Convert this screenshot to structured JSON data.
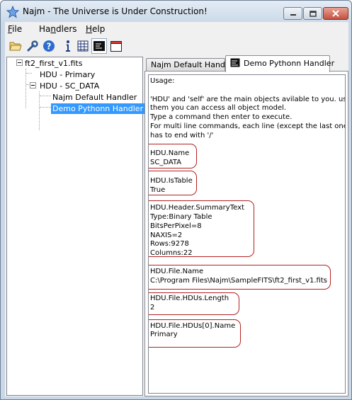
{
  "window": {
    "title": "Najm - The Universe is Under Construction!",
    "accent": "#3399ff",
    "annotation_color": "#b42121"
  },
  "caption_buttons": {
    "minimize_icon": "minimize-icon",
    "maximize_icon": "maximize-icon",
    "close_icon": "close-icon"
  },
  "menu": [
    {
      "label_acc": "F",
      "label_rest": "ile"
    },
    {
      "label_pre": "Ha",
      "label_acc": "n",
      "label_rest": "dlers"
    },
    {
      "label_acc": "H",
      "label_rest": "elp"
    }
  ],
  "toolbar": [
    "open-folder-icon",
    "wrench-icon",
    "help-icon",
    "info-icon",
    "grid-icon",
    "console-icon",
    "window-icon"
  ],
  "tree": {
    "root": "ft2_first_v1.fits",
    "hdu_primary": "HDU - Primary",
    "hdu_sc_data": "HDU - SC_DATA",
    "handler_default": "Najm Default Handler",
    "handler_python": "Demo Pythonn Handler"
  },
  "tabs": [
    {
      "label": "Najm Default Handler"
    },
    {
      "label": "Demo Pythonn Handler"
    }
  ],
  "console_lines": [
    "Usage:",
    "",
    "'HDU' and 'self' are the main objects avilable to you. using",
    "them you can access all object model.",
    " Type a command then enter to execute.",
    " For multi line commands, each line (except the last one)",
    "has to end with '/'",
    "",
    "HDU.Name",
    "SC_DATA",
    "",
    "HDU.IsTable",
    "True",
    "",
    "HDU.Header.SummaryText",
    "Type:Binary Table",
    "BitsPerPixel=8",
    "NAXIS=2",
    "Rows:9278",
    "Columns:22",
    "",
    "HDU.File.Name",
    "C:\\Program Files\\Najm\\SampleFITS\\ft2_first_v1.fits",
    "",
    "HDU.File.HDUs.Length",
    "2",
    "",
    "HDU.File.HDUs[0].Name",
    "Primary"
  ]
}
